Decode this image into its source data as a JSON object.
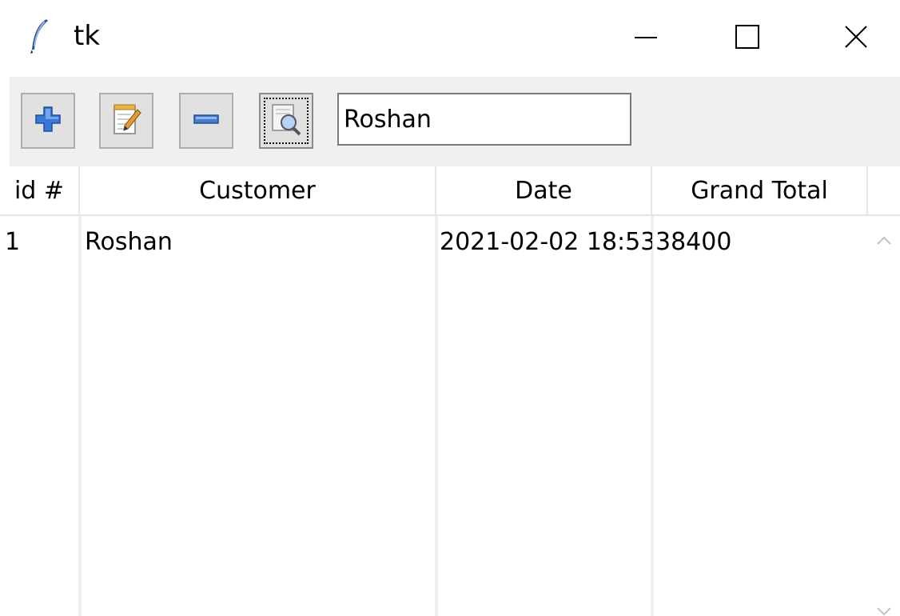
{
  "window": {
    "title": "tk",
    "icons": {
      "app": "feather-icon",
      "minimize": "minimize-icon",
      "maximize": "maximize-icon",
      "close": "close-icon"
    }
  },
  "toolbar": {
    "buttons": [
      {
        "name": "add-button",
        "icon": "plus-icon"
      },
      {
        "name": "edit-button",
        "icon": "notepad-edit-icon"
      },
      {
        "name": "remove-button",
        "icon": "minus-icon"
      },
      {
        "name": "search-button",
        "icon": "magnifier-icon"
      }
    ],
    "search_value": "Roshan"
  },
  "table": {
    "columns": [
      "id #",
      "Customer",
      "Date",
      "Grand Total"
    ],
    "rows": [
      {
        "id": "1",
        "customer": "Roshan",
        "date": "2021-02-02 18:53:",
        "grand_total": "38400"
      }
    ]
  },
  "colors": {
    "toolbar_bg": "#f0f0f0",
    "plus_blue": "#2f6fd0",
    "minus_blue": "#4a7ccc"
  }
}
